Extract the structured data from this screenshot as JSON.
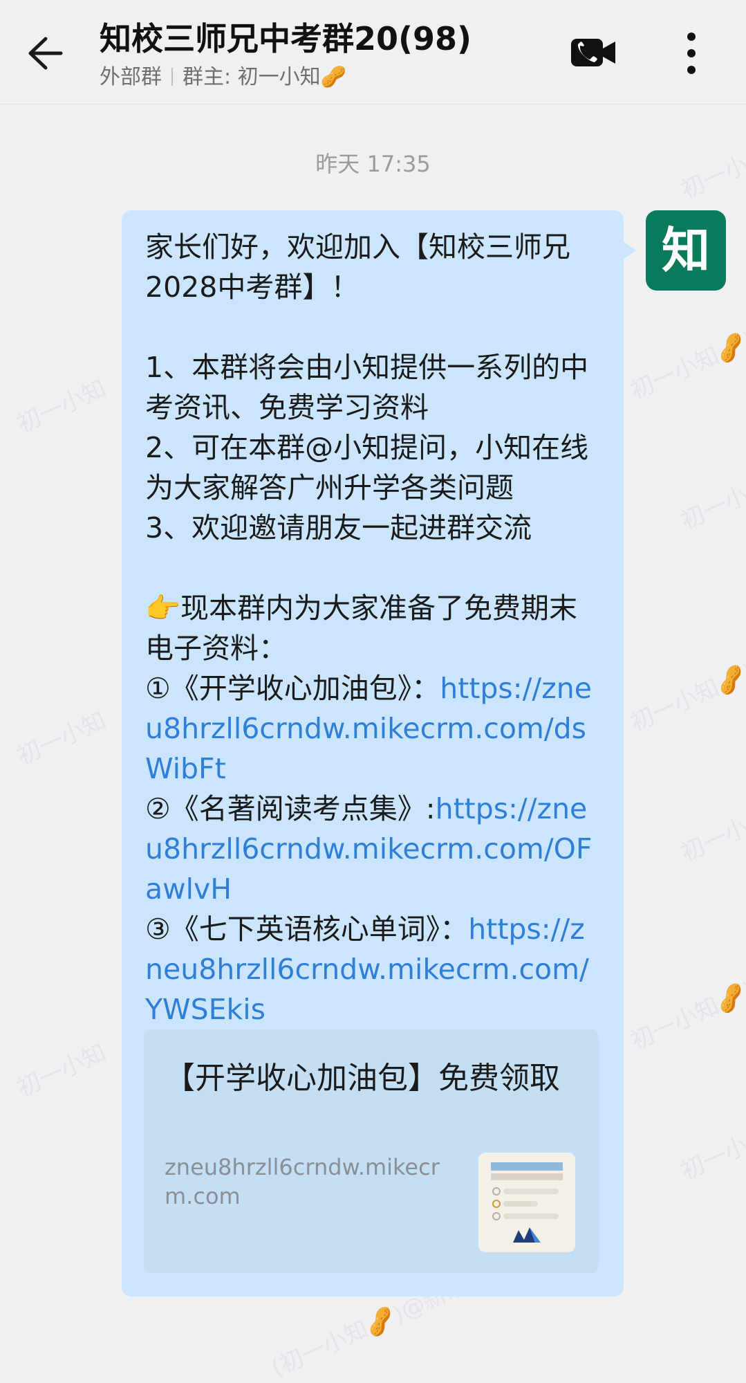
{
  "header": {
    "title": "知校三师兄中考群20",
    "title_faded": "",
    "member_count": "(98)",
    "tag": "外部群",
    "owner": "群主: 初一小知🥜",
    "back_icon": "arrow-left-icon",
    "video_icon": "video-call-icon",
    "more_icon": "more-vertical-icon"
  },
  "chat": {
    "timestamp": "昨天  17:35",
    "avatar_text": "知",
    "message": {
      "intro": "家长们好，欢迎加入【知校三师兄2028中考群】！",
      "item1": "1、本群将会由小知提供一系列的中考资讯、免费学习资料",
      "item2": "2、可在本群@小知提问，小知在线为大家解答广州升学各类问题",
      "item3": "3、欢迎邀请朋友一起进群交流",
      "notice": "👉现本群内为大家准备了免费期末电子资料：",
      "res1_label": "①《开学收心加油包》：",
      "res1_link": "https://zneu8hrzll6crndw.mikecrm.com/dsWibFt",
      "res2_label": "②《名著阅读考点集》:",
      "res2_link": "https://zneu8hrzll6crndw.mikecrm.com/OFawlvH",
      "res3_label": "③《七下英语核心单词》：",
      "res3_link": "https://zneu8hrzll6crndw.mikecrm.com/YWSEkis"
    },
    "card": {
      "title": "【开学收心加油包】免费领取",
      "domain": "zneu8hrzll6crndw.mikecrm.com"
    }
  },
  "watermark": {
    "a": "初一小知",
    "b": "初一小知🥜)@新东",
    "c": "(初一小知🥜)@新东"
  },
  "colors": {
    "background": "#eef0f2",
    "bubble": "#cbe6fc",
    "link": "#2f7ed8",
    "avatar": "#0a7a5d"
  }
}
